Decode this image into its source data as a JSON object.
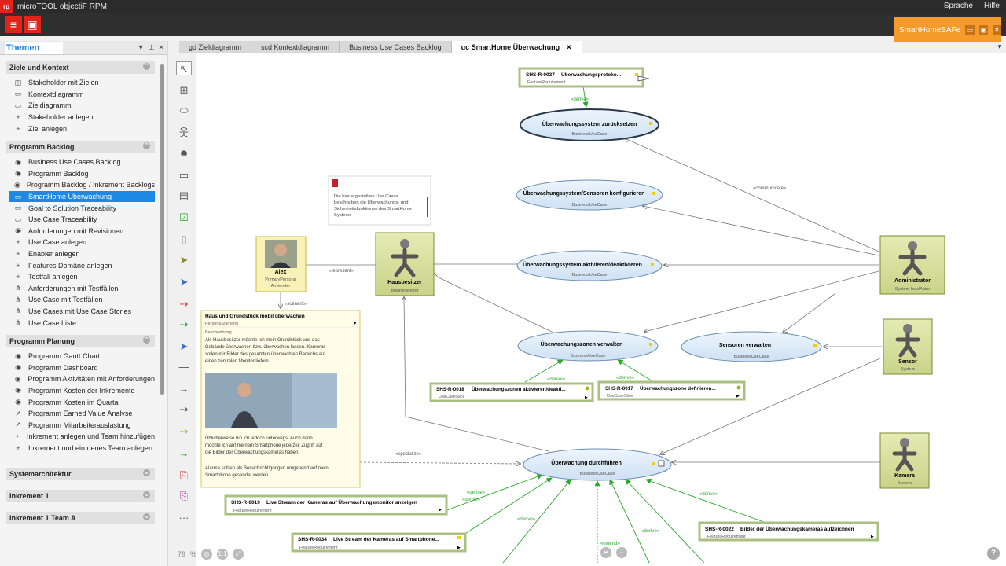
{
  "app": {
    "title": "microTOOL objectiF RPM",
    "logo": "rp",
    "menu": [
      "Sprache",
      "Hilfe"
    ],
    "project": "SmartHomeSAFe"
  },
  "sidebar": {
    "title": "Themen",
    "sections": [
      {
        "title": "Ziele und Kontext",
        "items": [
          {
            "icon": "◫",
            "label": "Stakeholder mit Zielen"
          },
          {
            "icon": "▭",
            "label": "Kontextdiagramm"
          },
          {
            "icon": "▭",
            "label": "Zieldiagramm"
          },
          {
            "icon": "+",
            "label": "Stakeholder anlegen"
          },
          {
            "icon": "+",
            "label": "Ziel anlegen"
          }
        ]
      },
      {
        "title": "Programm Backlog",
        "items": [
          {
            "icon": "◉",
            "label": "Business Use Cases Backlog"
          },
          {
            "icon": "◉",
            "label": "Programm Backlog"
          },
          {
            "icon": "◉",
            "label": "Programm Backlog / Inkrement Backlogs"
          },
          {
            "icon": "▭",
            "label": "SmartHome Überwachung",
            "selected": true
          },
          {
            "icon": "▭",
            "label": "Goal to Solution Traceability"
          },
          {
            "icon": "▭",
            "label": "Use Case Traceability"
          },
          {
            "icon": "◉",
            "label": "Anforderungen mit Revisionen"
          },
          {
            "icon": "+",
            "label": "Use Case anlegen"
          },
          {
            "icon": "+",
            "label": "Enabler anlegen"
          },
          {
            "icon": "+",
            "label": "Features Domäne anlegen"
          },
          {
            "icon": "+",
            "label": "Testfall anlegen"
          },
          {
            "icon": "⋔",
            "label": "Anforderungen mit Testfällen"
          },
          {
            "icon": "⋔",
            "label": "Use Case mit Testfällen"
          },
          {
            "icon": "⋔",
            "label": "Use Cases mit Use Case Stories"
          },
          {
            "icon": "⋔",
            "label": "Use Case Liste"
          }
        ]
      },
      {
        "title": "Programm Planung",
        "items": [
          {
            "icon": "◉",
            "label": "Programm Gantt Chart"
          },
          {
            "icon": "◉",
            "label": "Programm Dashboard"
          },
          {
            "icon": "◉",
            "label": "Programm Aktivitäten mit Anforderungen"
          },
          {
            "icon": "◉",
            "label": "Programm Kosten der Inkremente"
          },
          {
            "icon": "◉",
            "label": "Programm Kosten im Quartal"
          },
          {
            "icon": "↗",
            "label": "Programm Earned Value Analyse"
          },
          {
            "icon": "↗",
            "label": "Programm Mitarbeiterauslastung"
          },
          {
            "icon": "+",
            "label": "Inkrement anlegen und Team hinzufügen"
          },
          {
            "icon": "+",
            "label": "Inkrement und ein neues Team anlegen"
          }
        ]
      }
    ],
    "collapsed": [
      "Systemarchitektur",
      "Inkrement 1",
      "Inkrement 1 Team A"
    ]
  },
  "tabs": [
    {
      "label": "gd Zieldiagramm"
    },
    {
      "label": "scd Kontextdiagramm"
    },
    {
      "label": "Business Use Cases Backlog"
    },
    {
      "label": "uc SmartHome Überwachung",
      "active": true
    }
  ],
  "zoom": {
    "value": "79",
    "unit": "%"
  },
  "diagram": {
    "usecases": [
      {
        "name": "Überwachungssystem zurücksetzen",
        "stereo": "BusinessUseCase"
      },
      {
        "name": "Überwachungssystem/Sensoren konfigurieren",
        "stereo": "BusinessUseCase"
      },
      {
        "name": "Überwachungssystem aktivieren/deaktivieren",
        "stereo": "BusinessUseCase"
      },
      {
        "name": "Überwachungszonen verwalten",
        "stereo": "BusinessUseCase"
      },
      {
        "name": "Sensoren verwalten",
        "stereo": "BusinessUseCase"
      },
      {
        "name": "Überwachung durchführen",
        "stereo": "BusinessUseCase"
      }
    ],
    "actors": [
      {
        "name": "Hausbesitzer",
        "stereo": "BusinessActor"
      },
      {
        "name": "Administrator",
        "stereo": "System-levelActor"
      },
      {
        "name": "Sensor",
        "stereo": "System"
      },
      {
        "name": "Kamera",
        "stereo": "System"
      }
    ],
    "persona": {
      "name": "Alex",
      "stereo1": "PrimaryPersona",
      "stereo2": "Anwender"
    },
    "reqs": [
      {
        "id": "SHS-R-0037",
        "title": "Überwachungsprotoko...",
        "stereo": "FeatureRequirement"
      },
      {
        "id": "SHS-R-0018",
        "title": "Überwachungszonen aktivieren/deakti...",
        "stereo": "UseCaseSlice"
      },
      {
        "id": "SHS-R-0017",
        "title": "Überwachungszone definieren...",
        "stereo": "UseCaseSlice"
      },
      {
        "id": "SHS-R-0019",
        "title": "Live Stream der Kameras auf Überwachungsmonitor anzeigen",
        "stereo": "FeatureRequirement"
      },
      {
        "id": "SHS-R-0034",
        "title": "Live Stream der Kameras auf Smartphone...",
        "stereo": "FeatureRequirement"
      },
      {
        "id": "SHS-R-0022",
        "title": "Bilder der Überwachungskameras aufzeichnen",
        "stereo": "FeatureRequirement"
      }
    ],
    "note": {
      "lines": [
        "Die hier argestellten Use Cases",
        "beschreiben die Überwachungs- und",
        "Sicherheitsfunktionen des SmartHome",
        "Systems"
      ]
    },
    "scenario": {
      "title": "Haus und Grundstück mobil überwachen",
      "stereo": "PersonaScenario",
      "label": "Beschreibung",
      "para1": [
        "Als Hausbesitzer möchte ich mein Grundstück und das",
        "Gebäude überwachen  bzw. überwachen lassen. Kameras",
        "sollen mir Bilder des gesamten überwachten Bereichs auf",
        "einen zentralen Monitor liefern."
      ],
      "para2": [
        "Üblicherweise bin ich jedoch  unterwegs. Auch dann",
        "möchte ich auf meinem Smartphone jederzeit Zugriff auf",
        "die Bilder der Überwachungskameras haben."
      ],
      "para3": [
        "Alarme sollten als Benachrichtigungen umgehend auf mein",
        "Smartphone gesendet werden."
      ]
    },
    "labels": {
      "derive": "«derive»",
      "communicate": "«communicate»",
      "represent": "«represent»",
      "scenario": "«scenario»",
      "specialize": "«specialize»",
      "extend": "«extend»"
    }
  },
  "colors": {
    "accent": "#1e88e5",
    "brand": "#e2231a",
    "actorFill": "#d8e0a0",
    "usecaseFill": "#dceaf8",
    "derive": "#2aa82a"
  }
}
